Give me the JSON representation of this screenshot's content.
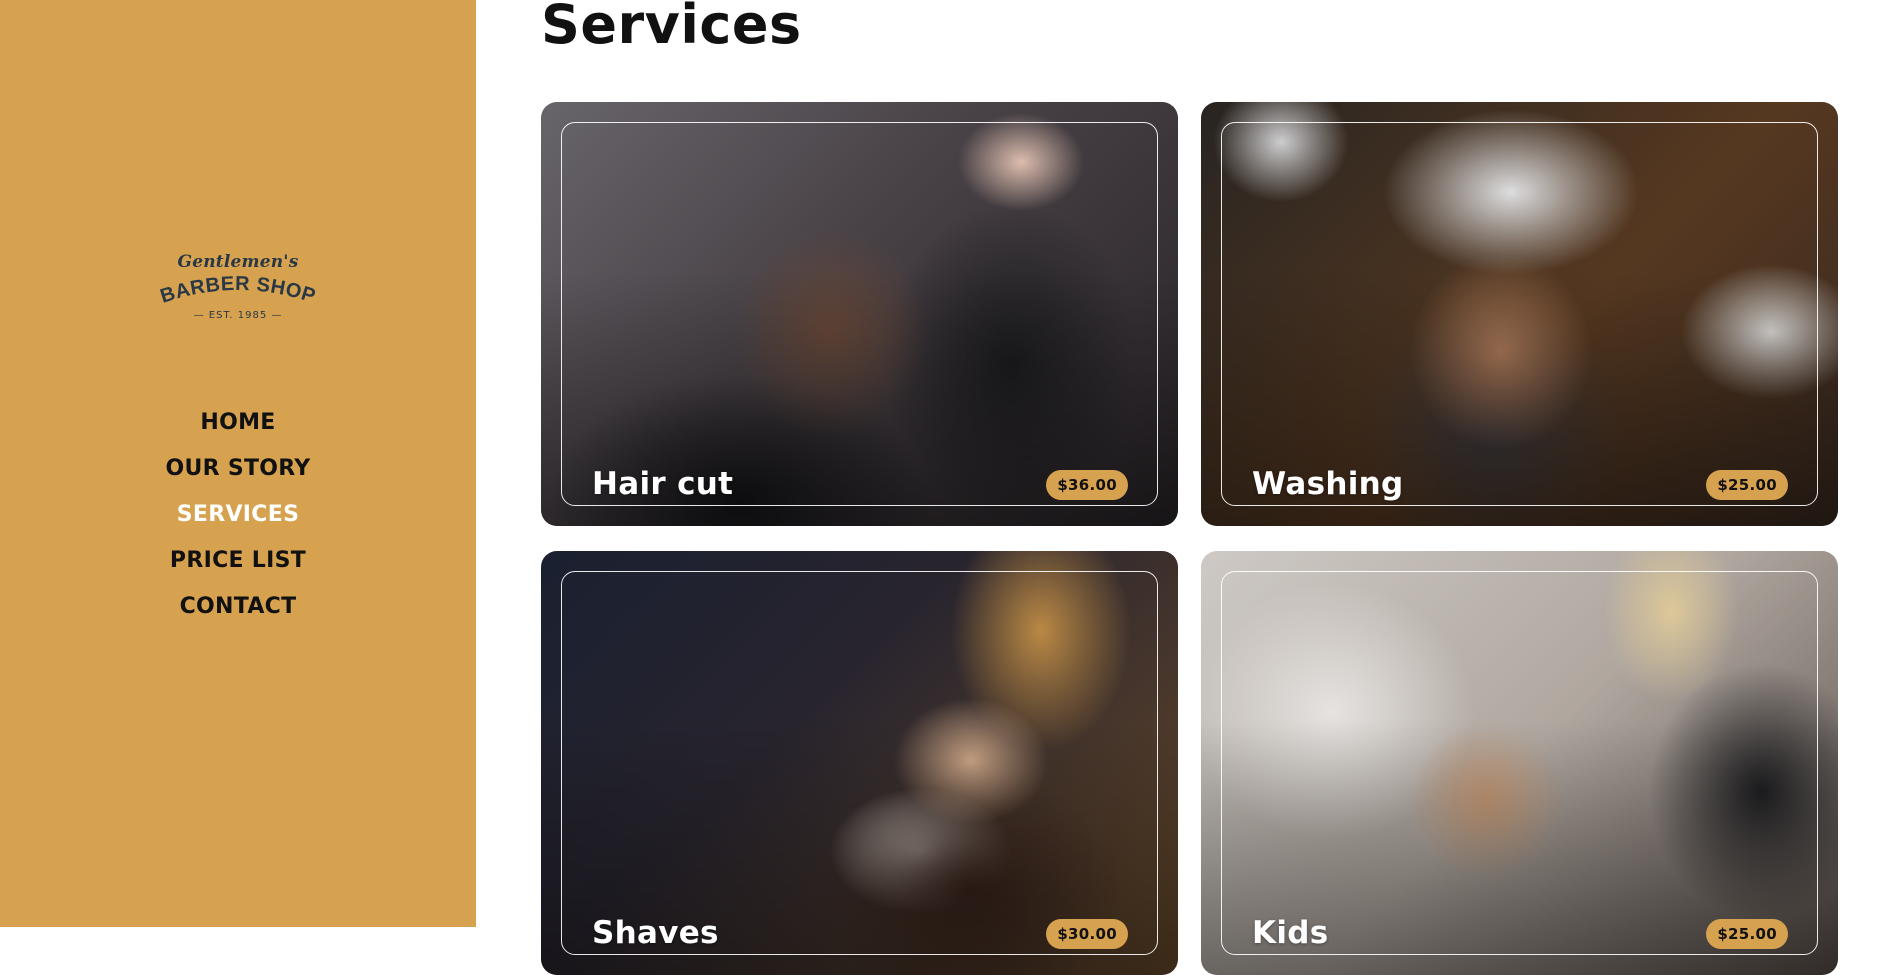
{
  "brand": {
    "logo_script": "Gentlemen's",
    "logo_main": "BARBER SHOP",
    "logo_est": "EST. 1985",
    "color": "#d6a24f",
    "logo_color": "#2a3845"
  },
  "nav": {
    "items": [
      {
        "label": "HOME",
        "active": false
      },
      {
        "label": "OUR STORY",
        "active": false
      },
      {
        "label": "SERVICES",
        "active": true
      },
      {
        "label": "PRICE LIST",
        "active": false
      },
      {
        "label": "CONTACT",
        "active": false
      }
    ]
  },
  "main": {
    "title": "Services",
    "cards": [
      {
        "name": "Hair cut",
        "price": "$36.00",
        "image": "barber-cutting-hair-photo"
      },
      {
        "name": "Washing",
        "price": "$25.00",
        "image": "hair-washing-photo"
      },
      {
        "name": "Shaves",
        "price": "$30.00",
        "image": "straight-razor-shave-photo"
      },
      {
        "name": "Kids",
        "price": "$25.00",
        "image": "kids-haircut-photo"
      }
    ]
  }
}
